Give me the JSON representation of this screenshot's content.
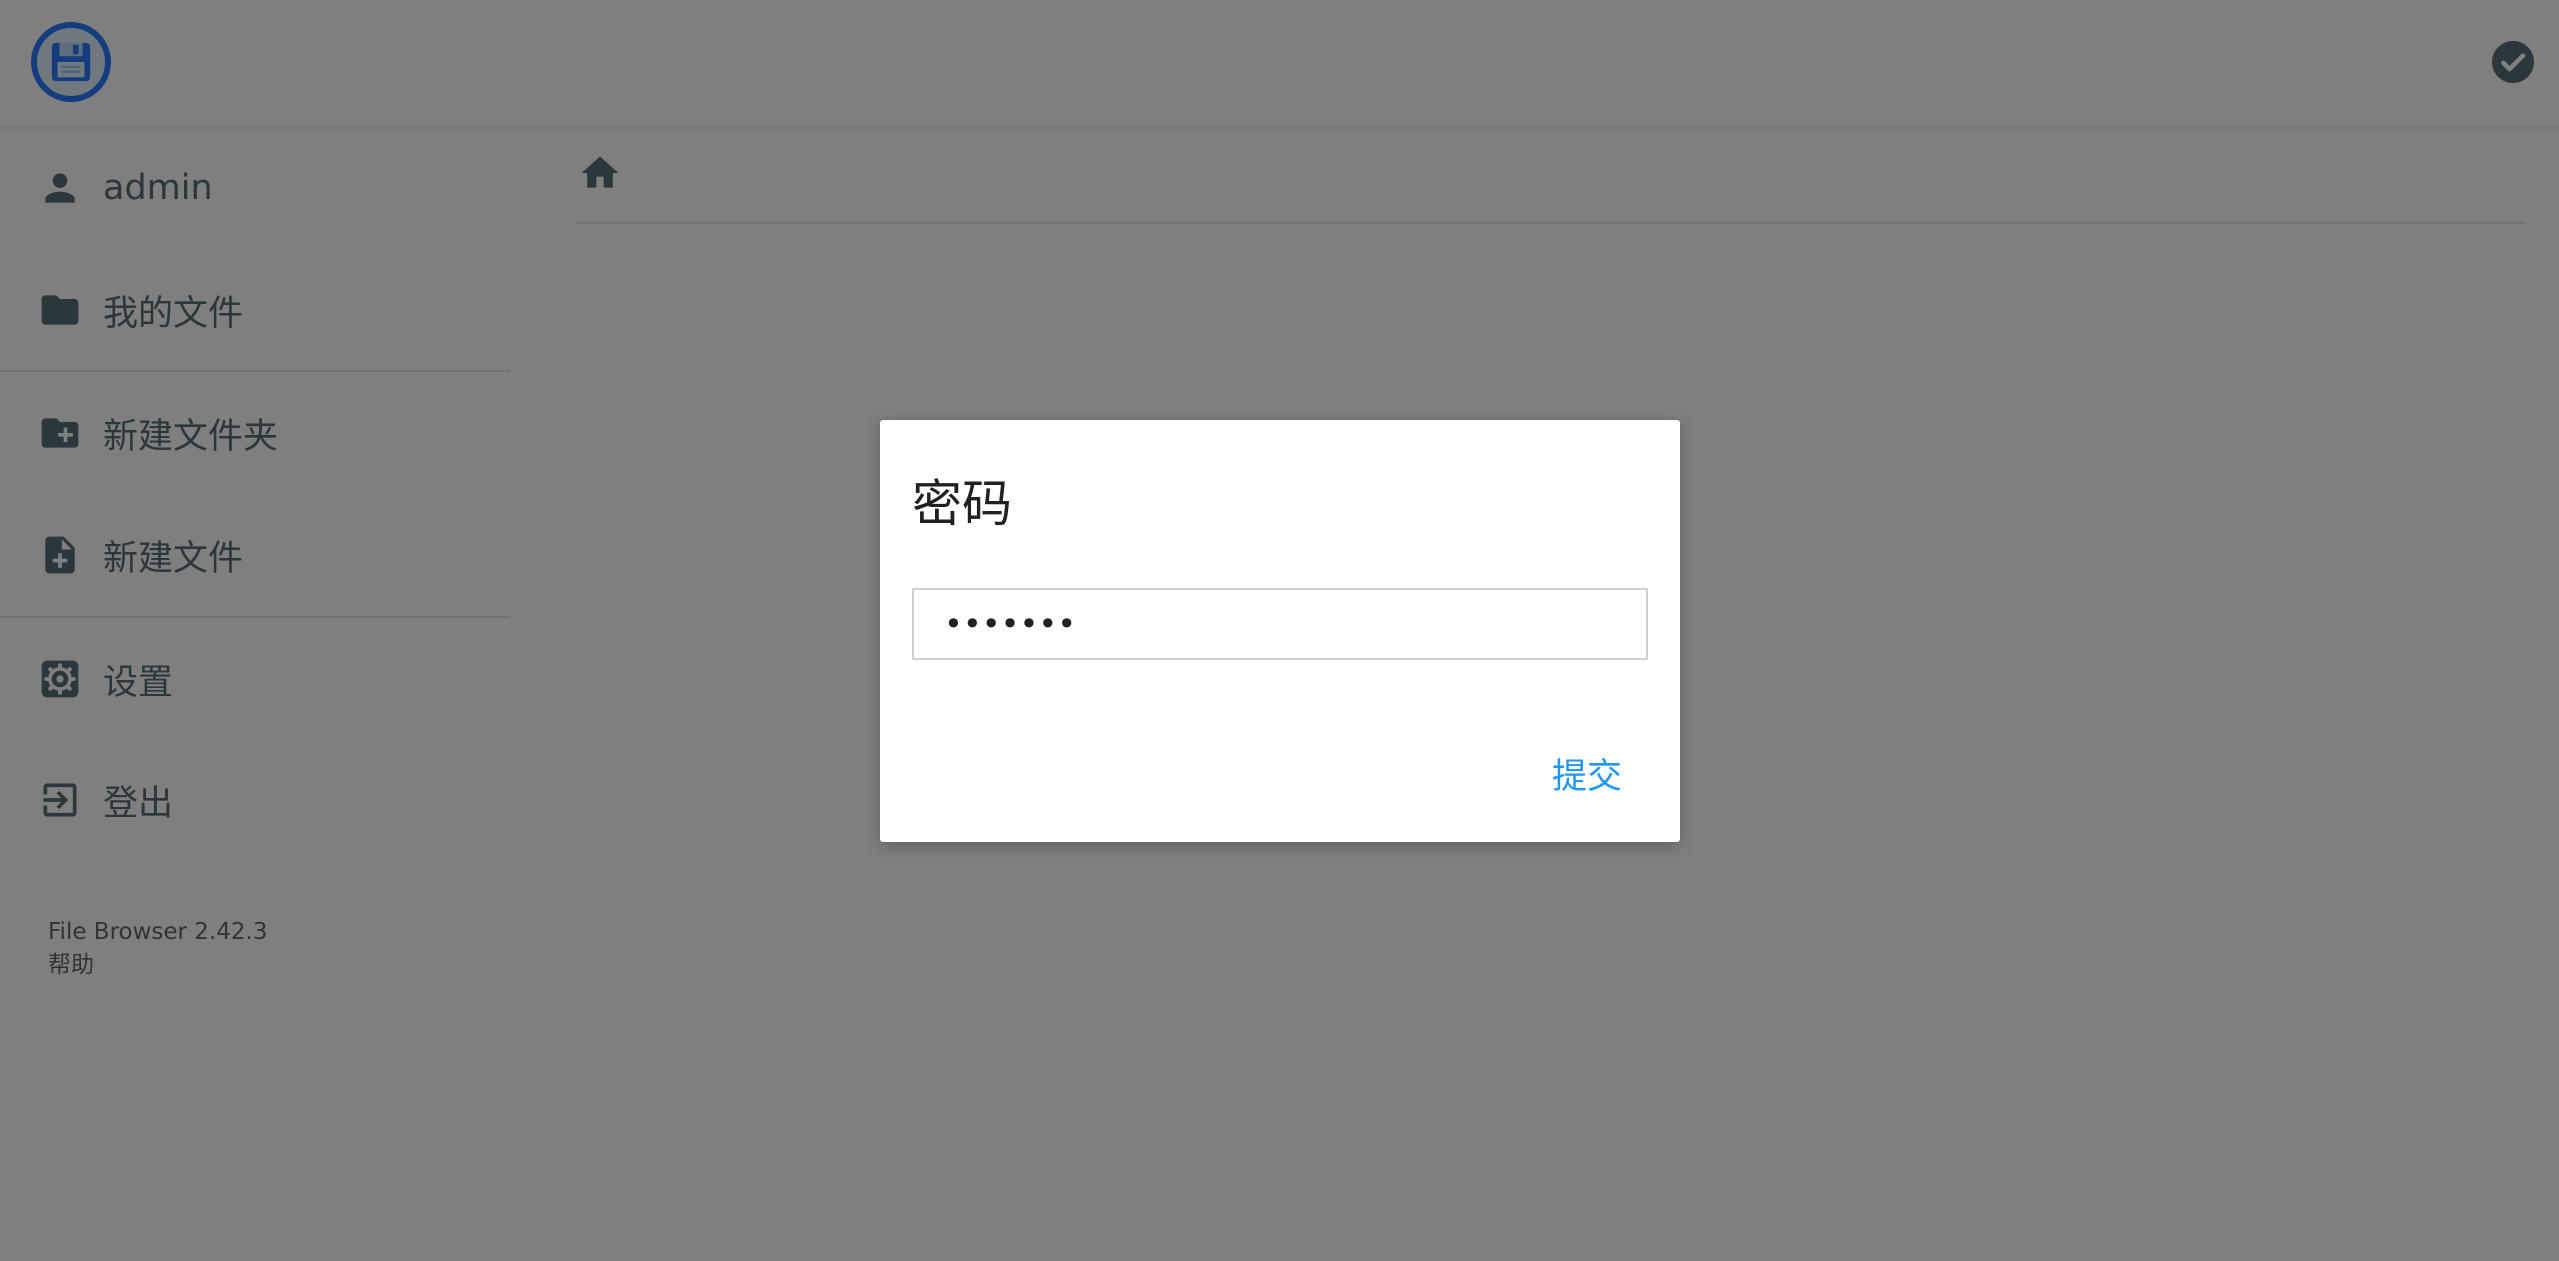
{
  "header": {
    "logo_icon": "floppy-disk-logo-icon",
    "check_icon": "check-circle-icon"
  },
  "sidebar": {
    "items": [
      {
        "label": "admin",
        "icon": "person-icon"
      },
      {
        "label": "我的文件",
        "icon": "folder-icon"
      },
      {
        "label": "新建文件夹",
        "icon": "folder-plus-icon"
      },
      {
        "label": "新建文件",
        "icon": "file-plus-icon"
      },
      {
        "label": "设置",
        "icon": "gear-icon"
      },
      {
        "label": "登出",
        "icon": "logout-icon"
      }
    ],
    "footer": {
      "version": "File Browser 2.42.3",
      "help": "帮助"
    }
  },
  "breadcrumb": {
    "home_icon": "home-icon"
  },
  "dialog": {
    "title": "密码",
    "password_value": "•••••••",
    "submit_label": "提交"
  },
  "colors": {
    "accent": "#2196f3",
    "icon": "#546e7a",
    "overlay": "rgba(0,0,0,0.5)"
  }
}
